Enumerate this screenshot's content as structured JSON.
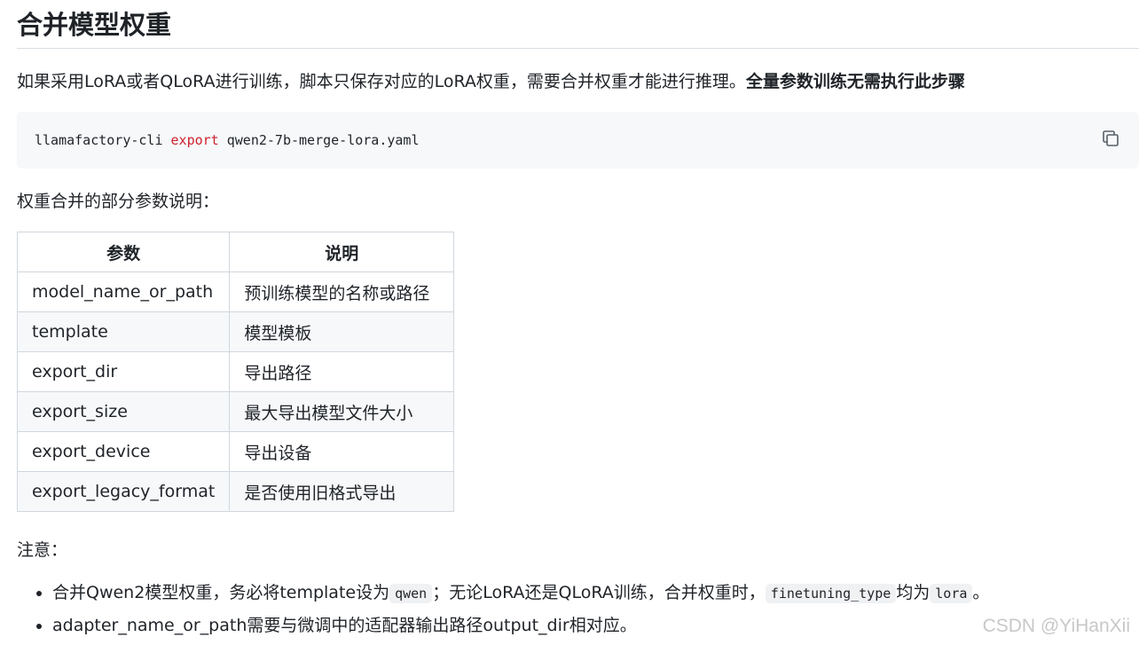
{
  "title": "合并模型权重",
  "intro": {
    "text": "如果采用LoRA或者QLoRA进行训练，脚本只保存对应的LoRA权重，需要合并权重才能进行推理。",
    "bold": "全量参数训练无需执行此步骤"
  },
  "code": {
    "cmd": "llamafactory-cli ",
    "keyword": "export",
    "arg": " qwen2-7b-merge-lora.yaml",
    "copy_icon": "copy-icon"
  },
  "param_intro": "权重合并的部分参数说明：",
  "table": {
    "headers": [
      "参数",
      "说明"
    ],
    "rows": [
      [
        "model_name_or_path",
        "预训练模型的名称或路径"
      ],
      [
        "template",
        "模型模板"
      ],
      [
        "export_dir",
        "导出路径"
      ],
      [
        "export_size",
        "最大导出模型文件大小"
      ],
      [
        "export_device",
        "导出设备"
      ],
      [
        "export_legacy_format",
        "是否使用旧格式导出"
      ]
    ]
  },
  "note_label": "注意：",
  "notes": {
    "n1_a": "合并Qwen2模型权重，务必将template设为",
    "n1_code1": "qwen",
    "n1_b": "；无论LoRA还是QLoRA训练，合并权重时，",
    "n1_code2": "finetuning_type",
    "n1_c": "均为",
    "n1_code3": "lora",
    "n1_d": "。",
    "n2": "adapter_name_or_path需要与微调中的适配器输出路径output_dir相对应。"
  },
  "watermark": "CSDN @YiHanXii"
}
